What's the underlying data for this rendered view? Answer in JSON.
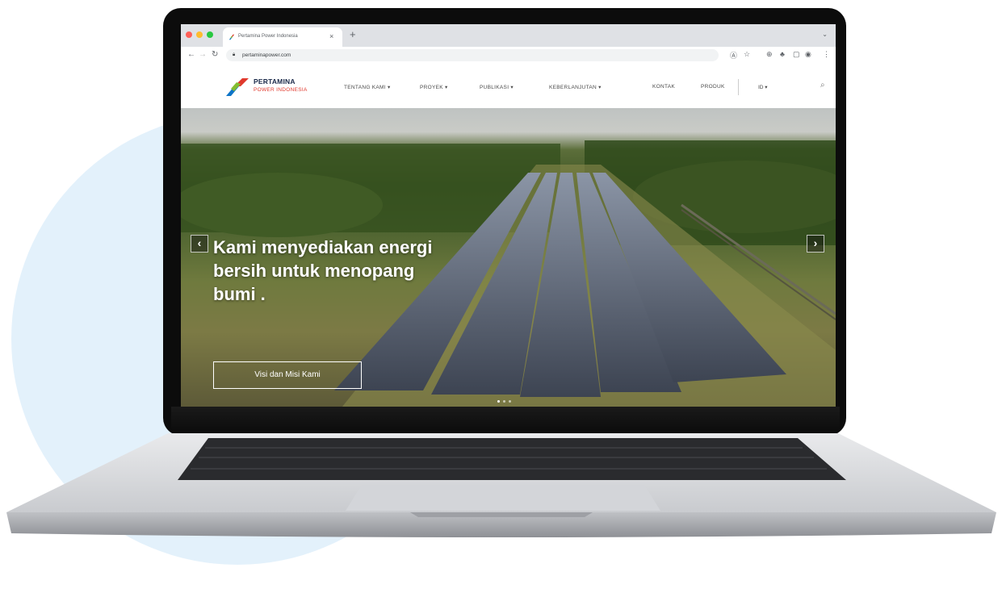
{
  "browser": {
    "tab_title": "Pertamina Power Indonesia",
    "tab_close": "×",
    "new_tab": "+",
    "url": "pertaminapower.com"
  },
  "site": {
    "brand": "PERTAMINA",
    "brand_sub": "POWER INDONESIA",
    "menu": [
      {
        "label": "TENTANG KAMI ▾"
      },
      {
        "label": "PROYEK ▾"
      },
      {
        "label": "PUBLIKASI ▾"
      },
      {
        "label": "KEBERLANJUTAN ▾"
      },
      {
        "label": "KONTAK"
      },
      {
        "label": "PRODUK"
      }
    ],
    "language": "ID ▾",
    "icons": {
      "search": "search-icon"
    }
  },
  "hero": {
    "headline": "Kami menyediakan energi bersih untuk menopang bumi .",
    "cta": "Visi dan Misi Kami",
    "prev": "‹",
    "next": "›",
    "slides": 3,
    "active_slide": 1
  },
  "colors": {
    "brand_navy": "#1b2a4a",
    "brand_red": "#e0382c",
    "brand_blue": "#0d74c7",
    "brand_green": "#84bd30",
    "bg_circle": "#e3f1fb"
  }
}
